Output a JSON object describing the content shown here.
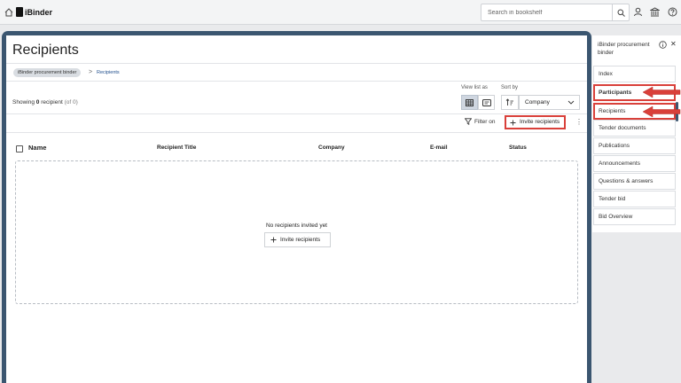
{
  "topbar": {
    "logo_text": "iBinder",
    "search_placeholder": "Search in bookshelf"
  },
  "page": {
    "title": "Recipients",
    "breadcrumb": {
      "root": "iBinder procurement binder",
      "separator": ">",
      "current": "Recipients"
    },
    "showing": {
      "prefix": "Showing",
      "count": "0",
      "unit": "recipient",
      "total": "(of 0)"
    },
    "view_list_label": "View list as",
    "sort_by_label": "Sort by",
    "sort_value": "Company",
    "filter_label": "Filter on",
    "invite_label": "Invite recipients",
    "columns": [
      "Name",
      "Recipient Title",
      "Company",
      "E-mail",
      "Status"
    ],
    "empty_text": "No recipients invited yet",
    "empty_invite_label": "Invite recipients"
  },
  "sidebar": {
    "title": "iBinder procurement binder",
    "items": [
      {
        "label": "Index"
      },
      {
        "label": "Participants"
      },
      {
        "label": "Recipients"
      },
      {
        "label": "Tender documents"
      },
      {
        "label": "Publications"
      },
      {
        "label": "Announcements"
      },
      {
        "label": "Questions & answers"
      },
      {
        "label": "Tender bid"
      },
      {
        "label": "Bid Overview"
      }
    ]
  },
  "colors": {
    "accent": "#3b5670",
    "highlight": "#d9403a",
    "link": "#1f4e8c"
  }
}
